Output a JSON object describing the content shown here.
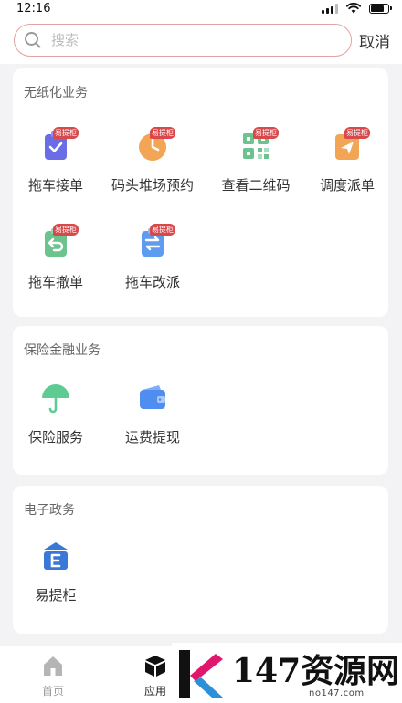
{
  "status_bar": {
    "time": "12:16"
  },
  "search": {
    "placeholder": "搜索",
    "value": "",
    "cancel_label": "取消"
  },
  "sections": [
    {
      "title": "无纸化业务",
      "items": [
        {
          "label": "拖车接单",
          "icon": "clipboard-check-icon",
          "color": "#6a6de6",
          "badge": "易提柜"
        },
        {
          "label": "码头堆场预约",
          "icon": "clock-icon",
          "color": "#f2a555",
          "badge": "易提柜"
        },
        {
          "label": "查看二维码",
          "icon": "qr-code-icon",
          "color": "#6cc38e",
          "badge": "易提柜"
        },
        {
          "label": "调度派单",
          "icon": "send-icon",
          "color": "#f2a555",
          "badge": "易提柜"
        },
        {
          "label": "拖车撤单",
          "icon": "undo-document-icon",
          "color": "#6cc38e",
          "badge": "易提柜"
        },
        {
          "label": "拖车改派",
          "icon": "swap-document-icon",
          "color": "#5e9cf0",
          "badge": "易提柜"
        }
      ]
    },
    {
      "title": "保险金融业务",
      "items": [
        {
          "label": "保险服务",
          "icon": "umbrella-icon",
          "color": "#5ecb92"
        },
        {
          "label": "运费提现",
          "icon": "wallet-icon",
          "color": "#4f8ef0"
        }
      ]
    },
    {
      "title": "电子政务",
      "items": [
        {
          "label": "易提柜",
          "icon": "e-box-icon",
          "color": "#3a78d8"
        }
      ]
    }
  ],
  "tab_bar": {
    "tabs": [
      {
        "label": "首页",
        "icon": "home-icon",
        "active": false
      },
      {
        "label": "应用",
        "icon": "cube-icon",
        "active": true
      }
    ]
  },
  "watermark": {
    "text": "147资源网",
    "url": "no147.com"
  }
}
